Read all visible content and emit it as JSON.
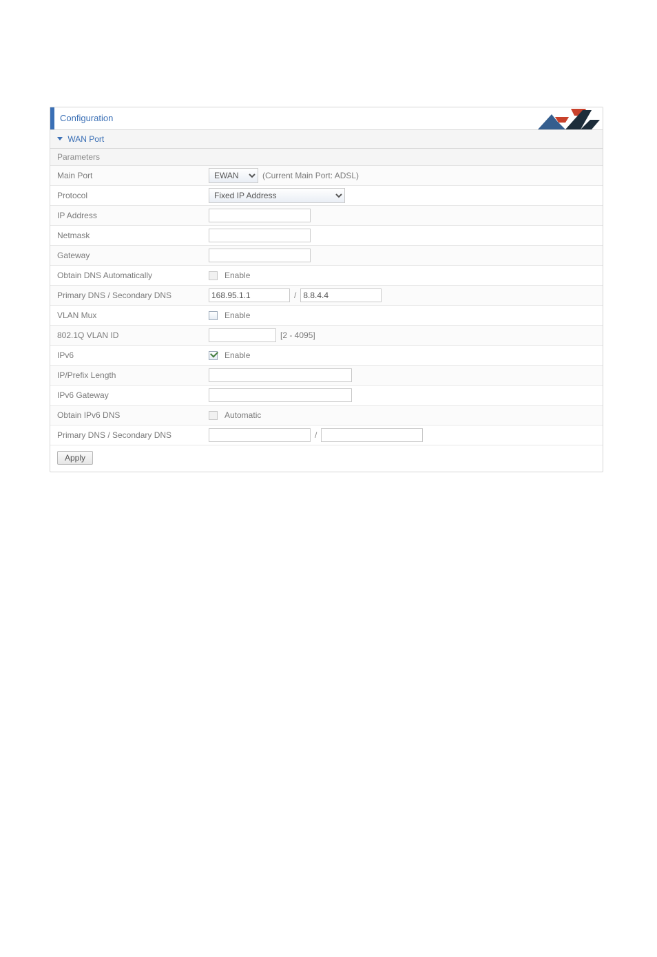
{
  "header": {
    "title": "Configuration"
  },
  "section": {
    "title": "WAN Port",
    "subtitle": "Parameters"
  },
  "rows": {
    "main_port": {
      "label": "Main Port",
      "select_value": "EWAN",
      "note": "(Current Main Port: ADSL)"
    },
    "protocol": {
      "label": "Protocol",
      "select_value": "Fixed IP Address"
    },
    "ip_address": {
      "label": "IP Address",
      "value": ""
    },
    "netmask": {
      "label": "Netmask",
      "value": ""
    },
    "gateway": {
      "label": "Gateway",
      "value": ""
    },
    "obtain_dns_auto": {
      "label": "Obtain DNS Automatically",
      "checkbox_label": "Enable"
    },
    "dns": {
      "label": "Primary DNS / Secondary DNS",
      "primary": "168.95.1.1",
      "secondary": "8.8.4.4"
    },
    "vlan_mux": {
      "label": "VLAN Mux",
      "checkbox_label": "Enable"
    },
    "vlan_id": {
      "label": "802.1Q VLAN ID",
      "value": "",
      "hint": "[2 - 4095]"
    },
    "ipv6": {
      "label": "IPv6",
      "checkbox_label": "Enable"
    },
    "ip_prefix_len": {
      "label": "IP/Prefix Length",
      "value": ""
    },
    "ipv6_gateway": {
      "label": "IPv6 Gateway",
      "value": ""
    },
    "obtain_ipv6_dns": {
      "label": "Obtain IPv6 DNS",
      "checkbox_label": "Automatic"
    },
    "ipv6_dns": {
      "label": "Primary DNS / Secondary DNS",
      "primary": "",
      "secondary": ""
    }
  },
  "buttons": {
    "apply": "Apply"
  },
  "separator": "/"
}
